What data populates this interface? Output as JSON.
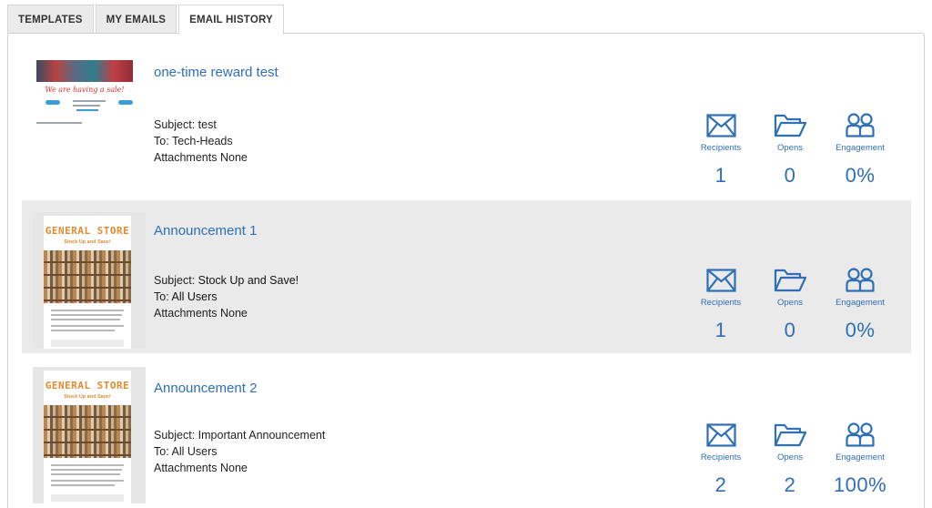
{
  "tabs": [
    {
      "label": "TEMPLATES"
    },
    {
      "label": "MY EMAILS"
    },
    {
      "label": "EMAIL HISTORY",
      "active": true
    }
  ],
  "labels": {
    "subject": "Subject:",
    "to": "To:",
    "attachments": "Attachments",
    "recipients": "Recipients",
    "opens": "Opens",
    "engagement": "Engagement"
  },
  "emails": [
    {
      "title": "one-time reward test",
      "subject": "test",
      "to": "Tech-Heads",
      "attachments": "None",
      "recipients": "1",
      "opens": "0",
      "engagement": "0%",
      "thumbnail": {
        "kind": "sale",
        "heading": "We are having a sale!"
      }
    },
    {
      "title": "Announcement 1",
      "subject": "Stock Up and Save!",
      "to": "All Users",
      "attachments": "None",
      "recipients": "1",
      "opens": "0",
      "engagement": "0%",
      "thumbnail": {
        "kind": "store",
        "heading": "GENERAL STORE",
        "subheading": "Stock Up and Save!"
      }
    },
    {
      "title": "Announcement 2",
      "subject": "Important Announcement",
      "to": "All Users",
      "attachments": "None",
      "recipients": "2",
      "opens": "2",
      "engagement": "100%",
      "thumbnail": {
        "kind": "store",
        "heading": "GENERAL STORE",
        "subheading": "Stock Up and Save!"
      }
    }
  ],
  "colors": {
    "accent": "#2e6fb7",
    "alt_row": "#eaeaea",
    "store_orange": "#e38b2f"
  },
  "icons": {
    "recipients": "envelope-icon",
    "opens": "folder-open-icon",
    "engagement": "users-icon"
  }
}
